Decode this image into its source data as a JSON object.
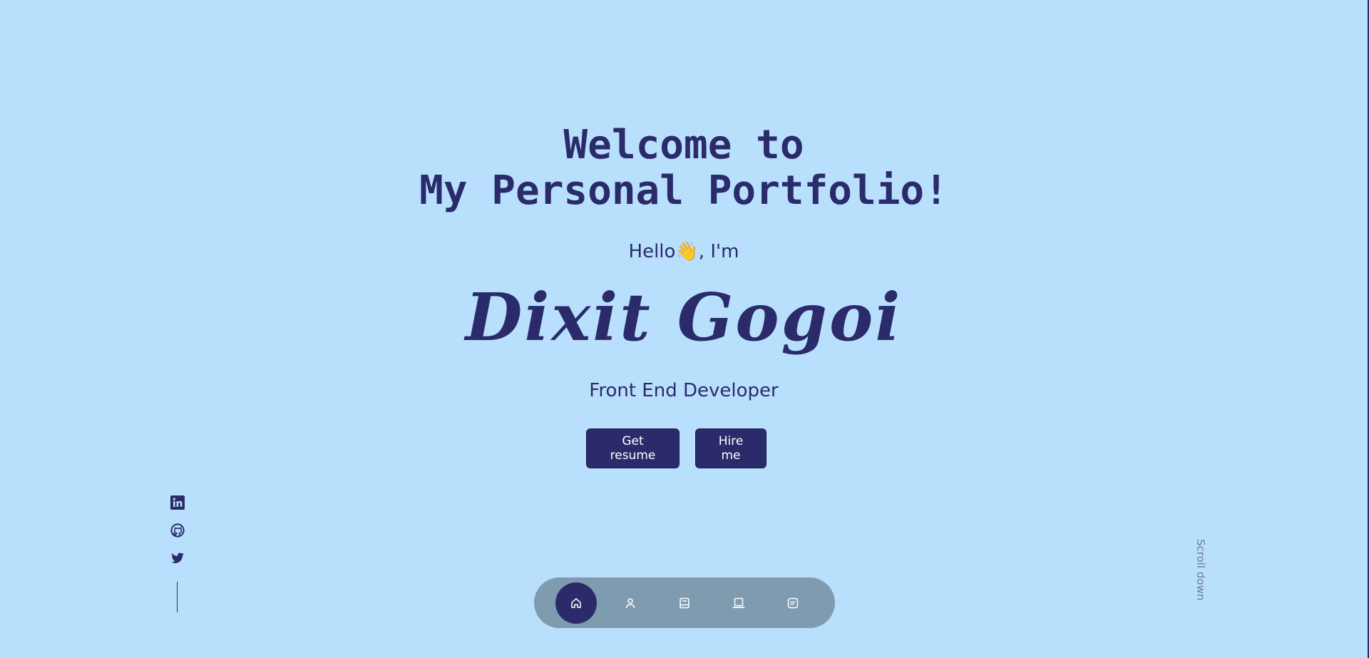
{
  "hero": {
    "headline_line1": "Welcome to",
    "headline_line2": "My Personal Portfolio!",
    "greeting_before": "Hello",
    "greeting_emoji": "👋",
    "greeting_after": ", I'm",
    "name": "Dixit Gogoi",
    "role": "Front End Developer"
  },
  "buttons": {
    "resume_label": "Get resume",
    "hire_label": "Hire me"
  },
  "socials": {
    "items": [
      {
        "icon": "linkedin-icon"
      },
      {
        "icon": "github-icon"
      },
      {
        "icon": "twitter-icon"
      }
    ]
  },
  "scroll": {
    "label": "Scroll down"
  },
  "nav": {
    "active": "home",
    "items": [
      {
        "icon": "home-icon"
      },
      {
        "icon": "user-icon"
      },
      {
        "icon": "book-icon"
      },
      {
        "icon": "laptop-icon"
      },
      {
        "icon": "message-icon"
      }
    ]
  },
  "colors": {
    "background": "#b8e0fd",
    "accent": "#2b2b6b",
    "navbar": "#7f9bb0",
    "muted_text": "#6b7b95"
  }
}
